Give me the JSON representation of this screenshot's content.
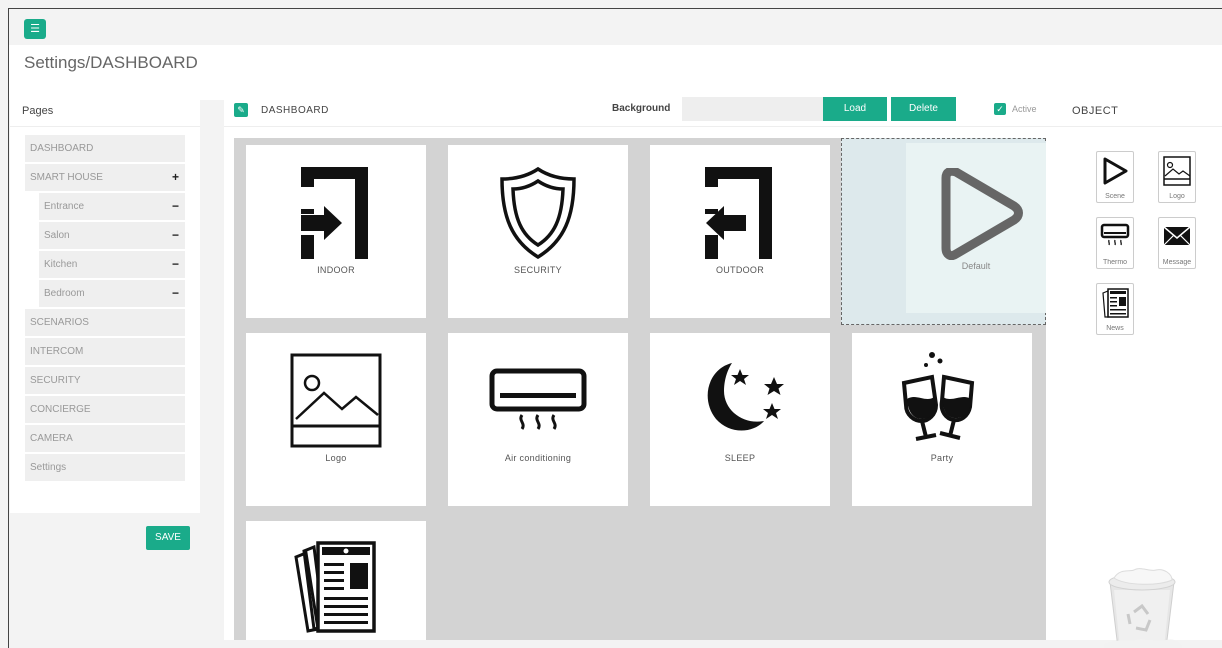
{
  "header": {
    "menu_icon": "hamburger-icon",
    "title": "Settings/DASHBOARD"
  },
  "pages_panel": {
    "title": "Pages",
    "items": [
      {
        "label": "DASHBOARD",
        "action": ""
      },
      {
        "label": "SMART HOUSE",
        "action": "+"
      },
      {
        "label": "Entrance",
        "action": "−",
        "sub": true
      },
      {
        "label": "Salon",
        "action": "−",
        "sub": true
      },
      {
        "label": "Kitchen",
        "action": "−",
        "sub": true
      },
      {
        "label": "Bedroom",
        "action": "−",
        "sub": true
      },
      {
        "label": "SCENARIOS",
        "action": ""
      },
      {
        "label": "INTERCOM",
        "action": ""
      },
      {
        "label": "SECURITY",
        "action": ""
      },
      {
        "label": "CONCIERGE",
        "action": ""
      },
      {
        "label": "CAMERA",
        "action": ""
      },
      {
        "label": "Settings",
        "action": ""
      }
    ],
    "save_label": "SAVE"
  },
  "dashboard": {
    "title": "DASHBOARD",
    "background_label": "Background",
    "background_value": "",
    "load_label": "Load",
    "delete_label": "Delete",
    "active_label": "Active",
    "active_checked": true,
    "tiles": [
      {
        "label": "INDOOR",
        "icon": "indoor-icon"
      },
      {
        "label": "SECURITY",
        "icon": "shield-icon"
      },
      {
        "label": "OUTDOOR",
        "icon": "outdoor-icon"
      },
      {
        "label": "Logo",
        "icon": "image-icon"
      },
      {
        "label": "Air conditioning",
        "icon": "air-conditioner-icon"
      },
      {
        "label": "SLEEP",
        "icon": "moon-stars-icon"
      },
      {
        "label": "Party",
        "icon": "wine-glasses-icon"
      },
      {
        "label": "",
        "icon": "newspaper-icon"
      }
    ],
    "dragging_tile": {
      "label": "Default",
      "icon": "play-icon"
    }
  },
  "object_panel": {
    "title": "OBJECT",
    "objects": [
      {
        "label": "Scene",
        "icon": "play-icon"
      },
      {
        "label": "Logo",
        "icon": "image-icon"
      },
      {
        "label": "Thermo",
        "icon": "air-conditioner-icon"
      },
      {
        "label": "Message",
        "icon": "envelope-icon"
      },
      {
        "label": "News",
        "icon": "newspaper-icon"
      }
    ],
    "trash_icon": "recycle-bin-icon"
  },
  "colors": {
    "accent": "#1aab8a",
    "grid_bg": "#d3d3d3"
  }
}
